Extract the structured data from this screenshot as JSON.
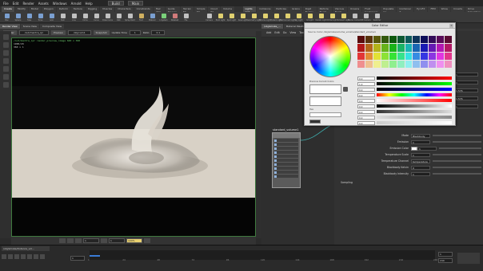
{
  "menu": {
    "items": [
      "File",
      "Edit",
      "Render",
      "Assets",
      "Windows",
      "Arnold",
      "Help"
    ],
    "desktop": "Build",
    "scene": "Main"
  },
  "shelf_tabs": [
    "Create",
    "Modify",
    "Model",
    "Polygon",
    "Deform",
    "Texture",
    "Rigging",
    "Muscles",
    "Characters",
    "Constraints",
    "Hair Utils",
    "Guide Process",
    "Terrain FX",
    "Simple FX",
    "Cloud FX",
    "Volume"
  ],
  "shelf_tabs2": [
    "Lights and...",
    "Collisions",
    "Particles",
    "Grains",
    "Rigid Bodies",
    "Particle Fluids",
    "Viscous Fluids",
    "Oceans",
    "Fluid Containers",
    "Populate Co...",
    "Container T...",
    "PyroFX",
    "FEM",
    "Wires",
    "Crowds",
    "Drive Simulation"
  ],
  "shelf_tools": [
    {
      "label": "Box",
      "color": "#7a9fd0"
    },
    {
      "label": "Sphere",
      "color": "#7a9fd0"
    },
    {
      "label": "Tube",
      "color": "#7a9fd0"
    },
    {
      "label": "Torus",
      "color": "#7a9fd0"
    },
    {
      "label": "Grid",
      "color": "#7a9fd0"
    },
    {
      "label": "Null",
      "color": "#c0c0c0"
    },
    {
      "label": "Line",
      "color": "#c0c0c0"
    },
    {
      "label": "Circle",
      "color": "#c0c0c0"
    },
    {
      "label": "Curve",
      "color": "#c0c0c0"
    },
    {
      "label": "Draw Curve",
      "color": "#c0c0c0"
    },
    {
      "label": "Path",
      "color": "#c0c0c0"
    },
    {
      "label": "Spray Paint",
      "color": "#c0c0c0"
    },
    {
      "label": "Font",
      "color": "#d0b060"
    },
    {
      "label": "Platonic",
      "color": "#7a9fd0"
    },
    {
      "label": "L-System",
      "color": "#7ad07a"
    },
    {
      "label": "Metaball",
      "color": "#d07a7a"
    },
    {
      "label": "File",
      "color": "#c0c0c0"
    }
  ],
  "shelf_tools2": [
    {
      "label": "Camera",
      "color": "#c0c0c0"
    },
    {
      "label": "Point Light",
      "color": "#e0d070"
    },
    {
      "label": "Spot Light",
      "color": "#e0d070"
    },
    {
      "label": "Area Light",
      "color": "#e0d070"
    },
    {
      "label": "Geometry Light",
      "color": "#e0d070"
    },
    {
      "label": "Volume Light",
      "color": "#e0d070"
    },
    {
      "label": "Distant Light",
      "color": "#e0d070"
    },
    {
      "label": "Environment Light",
      "color": "#e0d070"
    },
    {
      "label": "Sky Light",
      "color": "#e0d070"
    },
    {
      "label": "GI Light",
      "color": "#e0d070"
    },
    {
      "label": "Caustic Light",
      "color": "#e0d070"
    },
    {
      "label": "Portal Light",
      "color": "#e0d070"
    },
    {
      "label": "Ambient Light",
      "color": "#e0d070"
    },
    {
      "label": "Stereo Camera",
      "color": "#c0c0c0"
    },
    {
      "label": "VR Camera",
      "color": "#c0c0c0"
    },
    {
      "label": "Switcher",
      "color": "#c0c0c0"
    }
  ],
  "left_pane": {
    "tabs": [
      "Render View",
      "Scene View",
      "Composite View"
    ],
    "path": "/out/mantra_ipr",
    "buttons": [
      "Render",
      "Auto Update",
      "Preview"
    ],
    "camera": "/obj/cam1",
    "snapshot": "Snapshot",
    "update_label": "Update Time",
    "update_value": "1",
    "ratio_label": "Ratio",
    "ratio_value": "0.1",
    "overlay_lines": [
      "/out/mantra_ipr render_preview_image 640 x 360",
      "1900/29",
      "360 x 1"
    ]
  },
  "viewport_bar": {
    "frame": "1",
    "value": "1",
    "zoom": "100%"
  },
  "right_pane": {
    "tabs": [
      "/obj/smoke_...",
      "Material Palette",
      "Asset Browser"
    ],
    "menu": [
      "Add",
      "Edit",
      "Go",
      "View",
      "Tools",
      "Layout",
      "Help"
    ],
    "path": "shopnet"
  },
  "node": {
    "title": "standard_volume1",
    "rows": 10
  },
  "color_editor": {
    "title": "Color Editor",
    "subtitle": "Source: Color /obj/smoke/volume_volume/standard_volume1",
    "values": [
      "0.0",
      "1.0",
      "0.0",
      "0.0",
      "0.0",
      "0.0",
      "0.0",
      "0.0",
      "0.0"
    ],
    "left_label": "Previous Current Colors",
    "hex_label": "Hex"
  },
  "params": {
    "rows": [
      {
        "label": "Mode",
        "value": "Blackbody"
      },
      {
        "label": "Emission",
        "value": "1"
      },
      {
        "label": "Emission Color",
        "value": "1"
      },
      {
        "label": "Temperature Scale",
        "value": "1"
      },
      {
        "label": "Temperature Channel",
        "value": "temperature"
      },
      {
        "label": "Blackbody Kelvin",
        "value": "0"
      },
      {
        "label": "Blackbody Intensity",
        "value": "1"
      }
    ],
    "section": "Sampling",
    "side_values": [
      "1",
      "0",
      "0.576",
      "0.576",
      "1"
    ]
  },
  "timeline": {
    "start": "1",
    "end": "240",
    "current": "1",
    "ticks": [
      "1",
      "24",
      "48",
      "72",
      "96",
      "120",
      "144",
      "168",
      "192",
      "216",
      "240"
    ],
    "progress": 0.03,
    "status": "/obj/smoke/distance_vol..."
  }
}
